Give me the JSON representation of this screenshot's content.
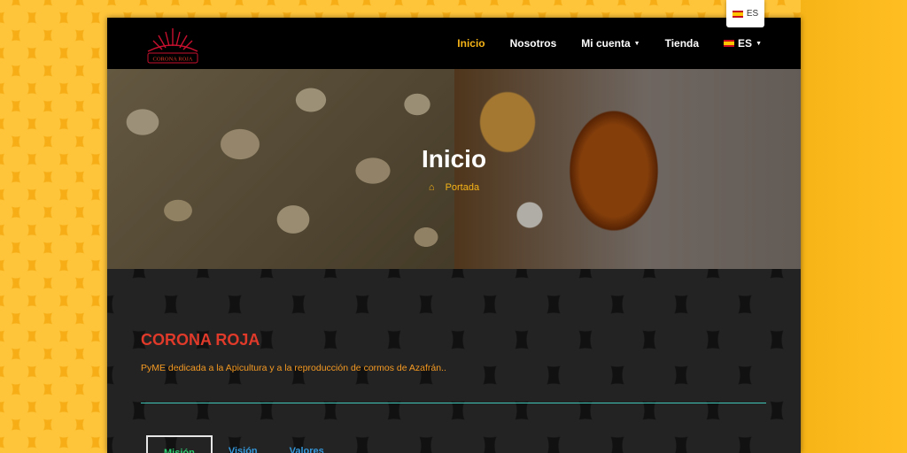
{
  "language_popover": {
    "label": "ES"
  },
  "navbar": {
    "logo_text": "CORONA ROJA",
    "items": [
      {
        "label": "Inicio",
        "active": true
      },
      {
        "label": "Nosotros"
      },
      {
        "label": "Mi cuenta",
        "dropdown": true
      },
      {
        "label": "Tienda"
      },
      {
        "label": "ES",
        "dropdown": true,
        "icon": "spain-flag-icon"
      }
    ]
  },
  "hero": {
    "title": "Inicio",
    "breadcrumb": "Portada"
  },
  "content": {
    "title": "CORONA ROJA",
    "description": "PyME dedicada a la Apicultura y a la reproducción de cormos de Azafrán..",
    "tabs": [
      {
        "label": "Misión",
        "active": true
      },
      {
        "label": "Visión"
      },
      {
        "label": "Valores"
      }
    ]
  },
  "colors": {
    "accent": "#f7b417",
    "brand_red": "#e03a2a",
    "desc_orange": "#f59a23",
    "divider": "#3fc6b8"
  }
}
